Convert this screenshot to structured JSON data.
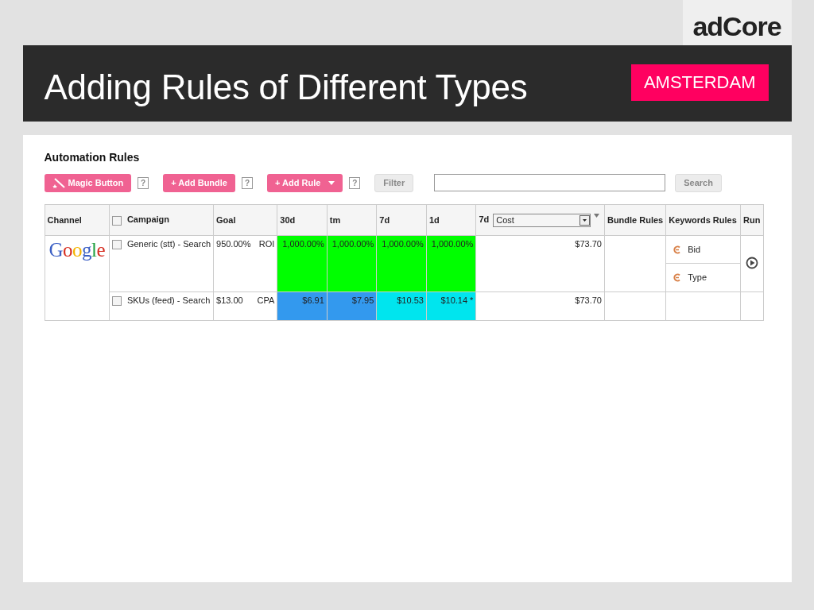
{
  "slide": {
    "logo": "adCore",
    "title": "Adding Rules of Different Types",
    "badge": "AMSTERDAM"
  },
  "app": {
    "heading": "Automation Rules",
    "toolbar": [
      {
        "kind": "magic",
        "label": "Magic Button",
        "help": "?"
      },
      {
        "kind": "add",
        "label": "+ Add Bundle",
        "help": "?"
      },
      {
        "kind": "dropdown",
        "label": "+ Add Rule",
        "help": "?"
      },
      {
        "kind": "filter",
        "label": "Filter"
      }
    ],
    "search": {
      "button": "Search"
    },
    "table": {
      "columns": [
        {
          "kind": "text",
          "label": "Channel"
        },
        {
          "kind": "checkbox",
          "label": "Campaign",
          "checked": false
        },
        {
          "kind": "text",
          "label": "Goal"
        },
        {
          "kind": "text",
          "label": "30d"
        },
        {
          "kind": "text",
          "label": "tm"
        },
        {
          "kind": "text",
          "label": "7d"
        },
        {
          "kind": "text",
          "label": "1d"
        },
        {
          "kind": "select",
          "label": "7d",
          "value": "Cost"
        },
        {
          "kind": "text",
          "label": "Bundle Rules"
        },
        {
          "kind": "text",
          "label": "Keywords Rules"
        },
        {
          "kind": "text",
          "label": "Run"
        }
      ],
      "channel": "Google",
      "rows": [
        {
          "checked": false,
          "campaign": "Generic (stt) - Search",
          "goal": "950.00%",
          "goal_type": "ROI",
          "metrics": [
            {
              "value": "1,000.00%",
              "color": "#00ff00"
            },
            {
              "value": "1,000.00%",
              "color": "#00ff00"
            },
            {
              "value": "1,000.00%",
              "color": "#00ff00"
            },
            {
              "value": "1,000.00%",
              "color": "#00ff00"
            }
          ],
          "cost": "$73.70",
          "keyword_rules": [
            "Bid",
            "Type"
          ],
          "run": true
        },
        {
          "checked": false,
          "campaign": "SKUs (feed) - Search",
          "goal": "$13.00",
          "goal_type": "CPA",
          "metrics": [
            {
              "value": "$6.91",
              "color": "#3399ee"
            },
            {
              "value": "$7.95",
              "color": "#3399ee"
            },
            {
              "value": "$10.53",
              "color": "#00e5ee"
            },
            {
              "value": "$10.14 *",
              "color": "#00e5ee"
            }
          ],
          "cost": "$73.70",
          "keyword_rules": [],
          "run": false
        }
      ]
    }
  }
}
